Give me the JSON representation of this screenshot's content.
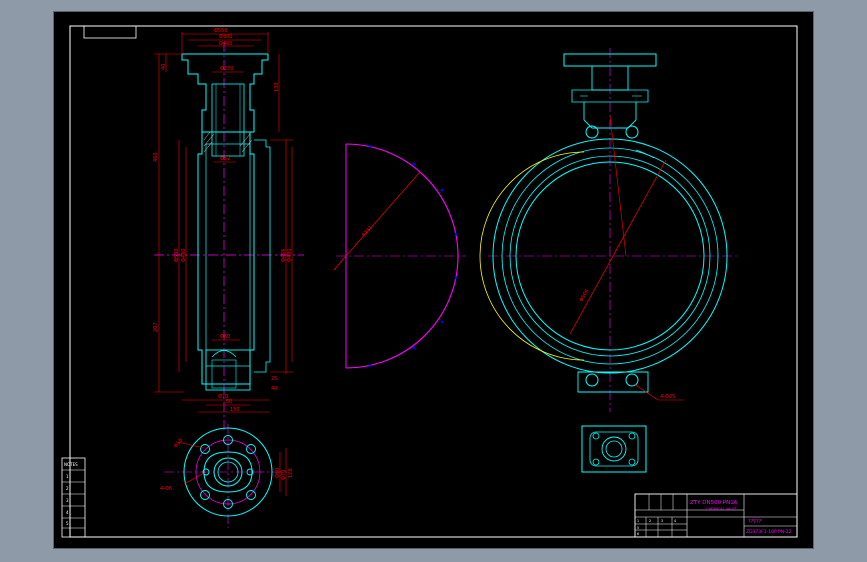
{
  "colors": {
    "background": "#8f9aa8",
    "sheet": "#000000",
    "border": "#ffffff",
    "part": "#00ffff",
    "dimension": "#ff0000",
    "centerline": "#ff00ff",
    "annotation": "#ffff00",
    "text_magenta": "#ff00ff",
    "green": "#00ff00"
  },
  "side_view": {
    "dims_top": [
      "Φ550",
      "Φ300",
      "Φ400"
    ],
    "dim_left_total": "460",
    "dim_left_upper": "40",
    "dim_left_lower": "207",
    "dim_upper_small": "130",
    "dim_mid_a": "Φ270",
    "dim_mid_b": "Φ52",
    "dim_body_a": "Φ530",
    "dim_body_b": "Φ480",
    "dim_body_c": "Φ455",
    "dim_body_d": "Φ430",
    "dim_bottom_a": "Φ60",
    "dim_bottom_b": "Φ70",
    "dim_bottom_c": "50",
    "dim_bottom_d": "150",
    "dim_bottom_e": "40",
    "dim_bottom_f": "25"
  },
  "disc_view": {
    "radius_label": "R251"
  },
  "front_view": {
    "diameter_label": "Φ506",
    "hole_label": "4-Φ25"
  },
  "flange_view": {
    "hole_label_left": "4-Φ6",
    "dim_a": "Φ80",
    "dim_b": "Φ70",
    "dim_c": "120",
    "dim_d": "Φ18"
  },
  "title_block": {
    "project_title": "ZTY  DN500 PN16 ",
    "project_sub": "CHEMICAL VALVE",
    "drawing_name": "?????",
    "drawing_no": "ZD373F1-16P PN-22"
  },
  "left_block": {
    "header": "NOTES"
  }
}
